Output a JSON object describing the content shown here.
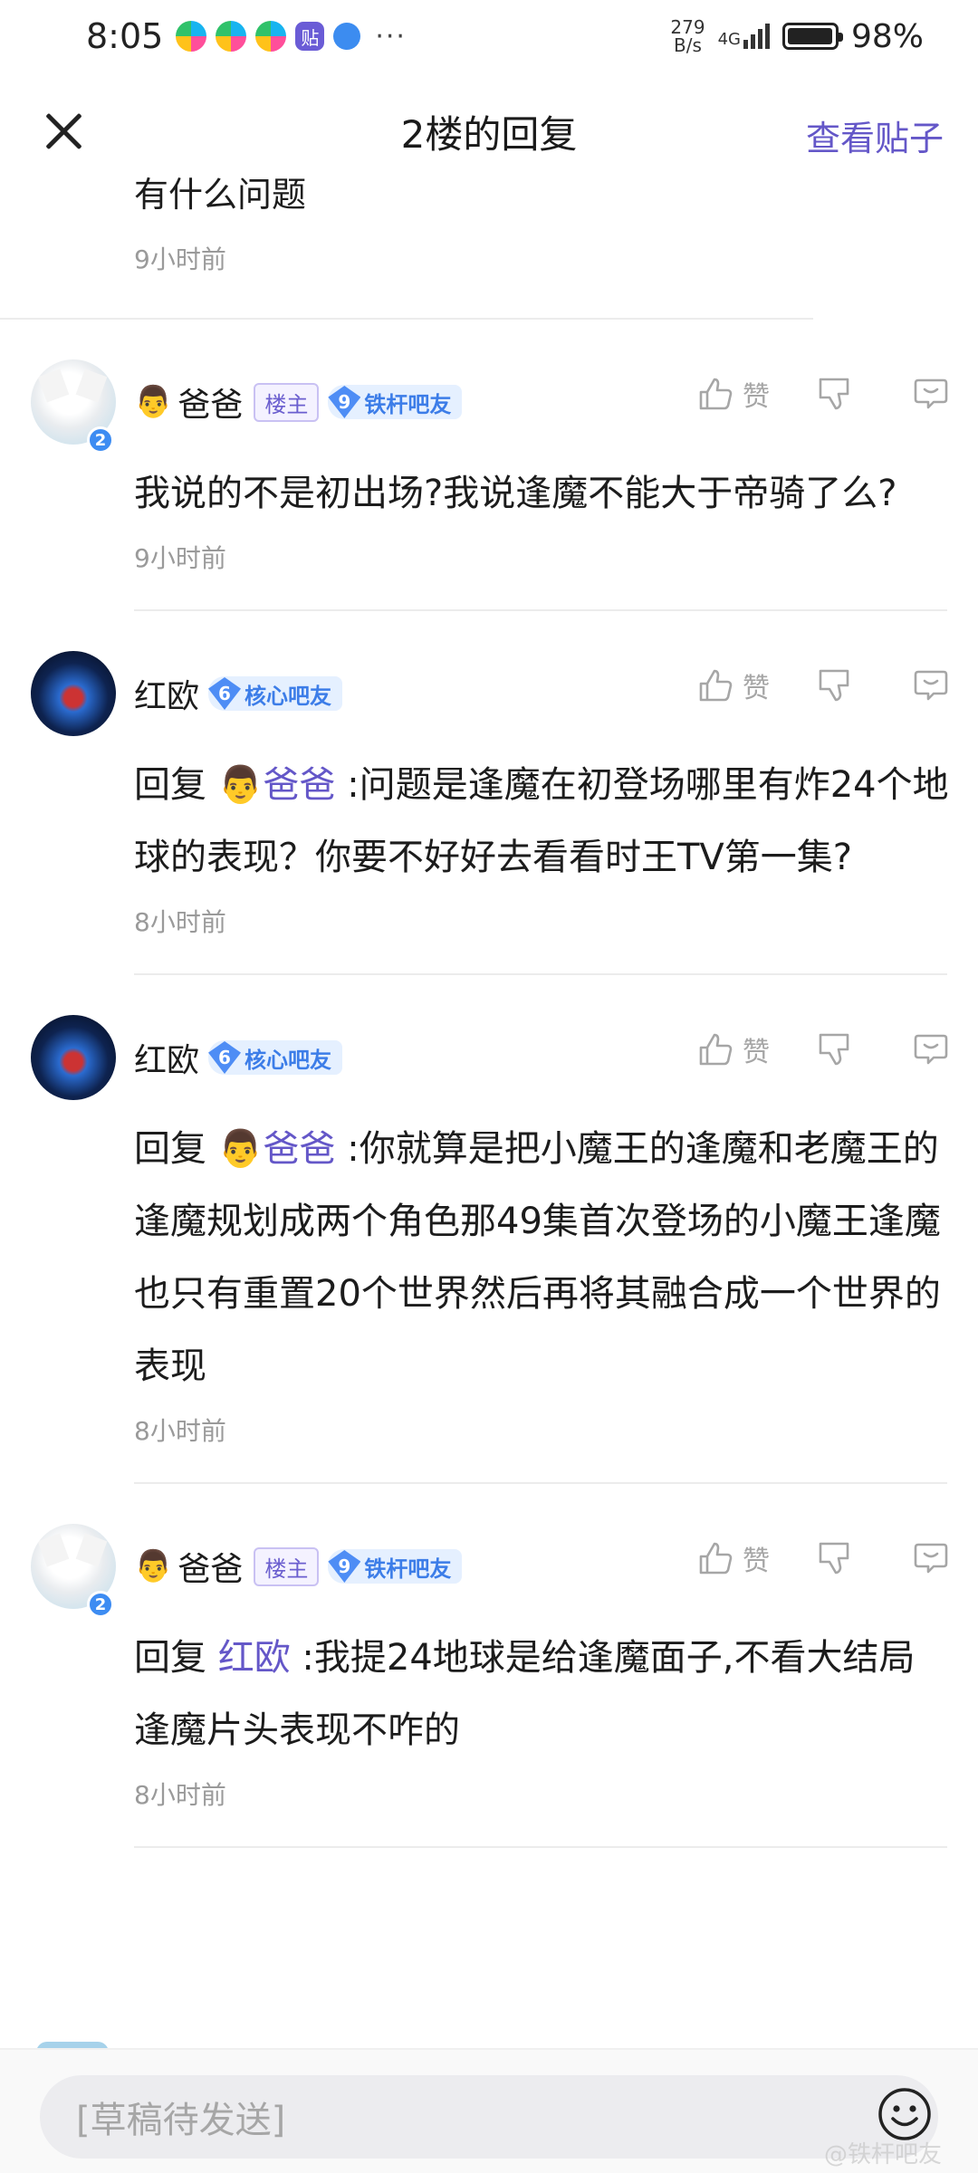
{
  "status_bar": {
    "time": "8:05",
    "net_speed_top": "279",
    "net_speed_bottom": "B/s",
    "network": "4G",
    "battery_text": "98%",
    "battery_level": 0.98,
    "notif_tieba": "贴",
    "notif_more": "···"
  },
  "nav": {
    "title": "2楼的回复",
    "right_link": "查看贴子"
  },
  "prev": {
    "text": "有什么问题",
    "time": "9小时前"
  },
  "comments": [
    {
      "name": "爸爸",
      "emoji": "👨",
      "owner_tag": "楼主",
      "fan_level": "9",
      "fan_label": "铁杆吧友",
      "avatar_badge": "2",
      "like_label": "赞",
      "text": "我说的不是初出场?我说逢魔不能大于帝骑了么?",
      "time": "9小时前"
    },
    {
      "name": "红欧",
      "fan_level": "6",
      "fan_label": "核心吧友",
      "like_label": "赞",
      "reply_prefix": "回复 ",
      "reply_emoji": "👨",
      "reply_user": "爸爸",
      "text": " :问题是逢魔在初登场哪里有炸24个地球的表现？你要不好好去看看时王TV第一集?",
      "time": "8小时前"
    },
    {
      "name": "红欧",
      "fan_level": "6",
      "fan_label": "核心吧友",
      "like_label": "赞",
      "reply_prefix": "回复 ",
      "reply_emoji": "👨",
      "reply_user": "爸爸",
      "text": " :你就算是把小魔王的逢魔和老魔王的逢魔规划成两个角色那49集首次登场的小魔王逢魔也只有重置20个世界然后再将其融合成一个世界的表现",
      "time": "8小时前"
    },
    {
      "name": "爸爸",
      "emoji": "👨",
      "owner_tag": "楼主",
      "fan_level": "9",
      "fan_label": "铁杆吧友",
      "avatar_badge": "2",
      "like_label": "赞",
      "reply_prefix": "回复 ",
      "reply_user": "红欧",
      "text": " :我提24地球是给逢魔面子,不看大结局逢魔片头表现不咋的",
      "time": "8小时前"
    }
  ],
  "input": {
    "placeholder": "[草稿待发送]"
  },
  "watermark": "@铁杆吧友"
}
